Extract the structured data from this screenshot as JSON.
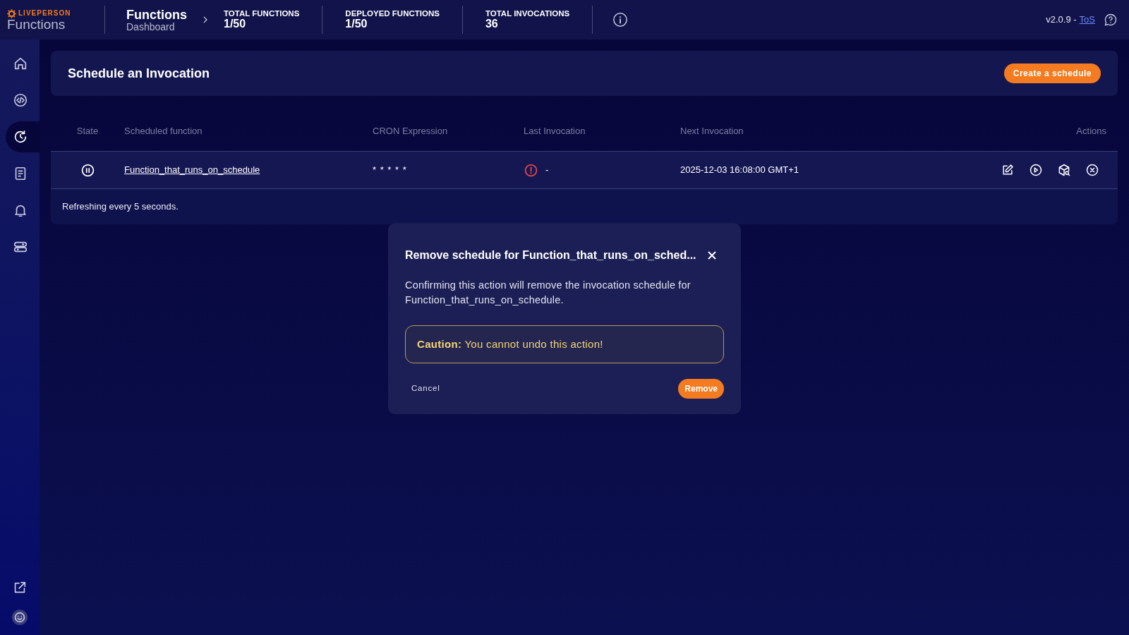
{
  "header": {
    "brand": "LIVEPERSON",
    "product": "Functions",
    "page_title": "Functions",
    "page_subtitle": "Dashboard",
    "stats": [
      {
        "label": "TOTAL FUNCTIONS",
        "value": "1/50"
      },
      {
        "label": "DEPLOYED FUNCTIONS",
        "value": "1/50"
      },
      {
        "label": "TOTAL INVOCATIONS",
        "value": "36"
      }
    ],
    "version": "v2.0.9 -",
    "tos_link": "ToS"
  },
  "sidebar": {
    "items": [
      {
        "kind": "home",
        "selected": false
      },
      {
        "kind": "code",
        "selected": false
      },
      {
        "kind": "schedule",
        "selected": true
      },
      {
        "kind": "logs",
        "selected": false
      },
      {
        "kind": "alerts",
        "selected": false
      },
      {
        "kind": "settings",
        "selected": false
      }
    ],
    "bottom": [
      {
        "kind": "external"
      },
      {
        "kind": "avatar"
      }
    ]
  },
  "panel": {
    "title": "Schedule an Invocation",
    "create_button": "Create a schedule"
  },
  "table": {
    "columns": [
      "State",
      "Scheduled function",
      "CRON Expression",
      "Last Invocation",
      "Next Invocation",
      "Actions"
    ],
    "rows": [
      {
        "state": {
          "kind": "paused"
        },
        "function": "Function_that_runs_on_schedule",
        "cron": "* * * * *",
        "last_status": {
          "kind": "error"
        },
        "last_invocation": "-",
        "next_invocation": "2025-12-03 16:08:00 GMT+1",
        "actions": [
          {
            "kind": "edit"
          },
          {
            "kind": "run"
          },
          {
            "kind": "inspect"
          },
          {
            "kind": "delete"
          }
        ]
      }
    ]
  },
  "refresh_note": "Refreshing every 5 seconds.",
  "dialog": {
    "title": "Remove schedule for Function_that_runs_on_sched...",
    "message": "Confirming this action will remove the invocation schedule for Function_that_runs_on_schedule.",
    "caution": "**Caution:** You cannot undo this action!",
    "cancel": "Cancel",
    "confirm": "Remove"
  }
}
